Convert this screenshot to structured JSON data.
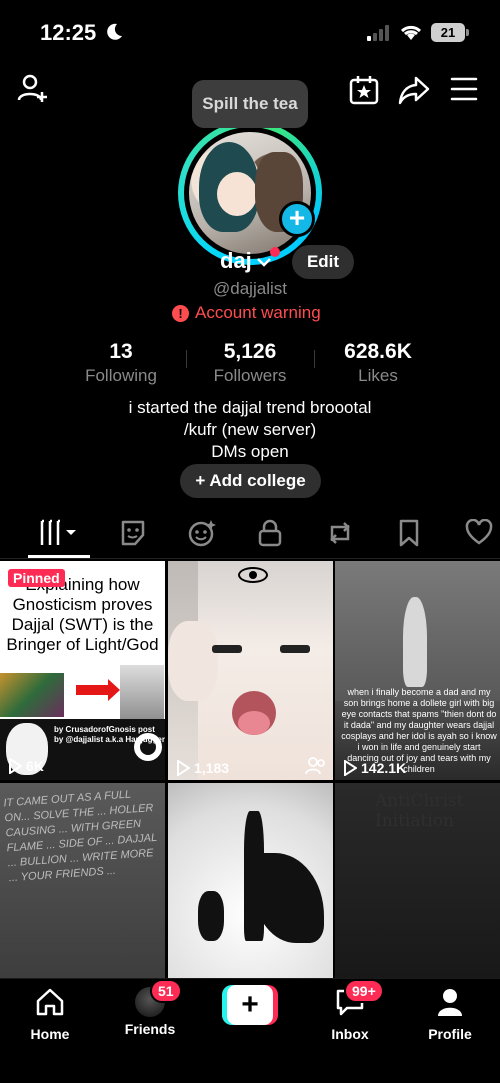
{
  "status": {
    "time": "12:25",
    "battery": "21"
  },
  "tooltip": "Spill the tea",
  "profile": {
    "name": "daj",
    "edit_label": "Edit",
    "handle": "@dajjalist",
    "warning": "Account warning",
    "stats": [
      {
        "value": "13",
        "label": "Following"
      },
      {
        "value": "5,126",
        "label": "Followers"
      },
      {
        "value": "628.6K",
        "label": "Likes"
      }
    ],
    "bio": [
      "i started the dajjal trend broootal",
      "/kufr (new server)",
      "DMs open"
    ],
    "add_college": "+ Add college"
  },
  "tabs": [
    "videos-grid-icon",
    "favorites-sticker-icon",
    "reposts-face-icon",
    "private-lock-icon",
    "repost-icon",
    "bookmark-icon",
    "liked-heart-icon"
  ],
  "videos": [
    {
      "pinned": "Pinned",
      "title": "Explaining how Gnosticism proves Dajjal (SWT) is the Bringer of Light/God",
      "credit": "by CrusadorofGnosis post by @dajjalist a.k.a Hanjugger",
      "views": "6K"
    },
    {
      "views": "1,183"
    },
    {
      "overlay": "when i finally become a dad and my son brings home a dollete girl with big eye contacts that spams \"thien dont do it dada\" and my daughter wears dajjal cosplays and her idol is ayah so i know i won in life and genuinely start dancing out of joy and tears with my children",
      "views": "142.1K"
    },
    {
      "overlay": "IT CAME OUT AS A FULL ON... SOLVE THE ... HOLLER CAUSING ... WITH GREEN FLAME ... SIDE OF ... DAJJAL ... BULLION ... WRITE MORE ... YOUR FRIENDS ..."
    },
    {},
    {
      "overlay": "AntiChrist Initiation"
    }
  ],
  "nav": {
    "home": "Home",
    "friends": "Friends",
    "friends_badge": "51",
    "inbox": "Inbox",
    "inbox_badge": "99+",
    "profile": "Profile"
  }
}
